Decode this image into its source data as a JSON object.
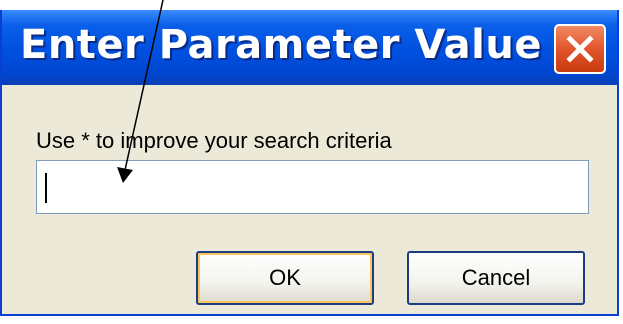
{
  "dialog": {
    "title": "Enter Parameter Value",
    "close_icon": "close-icon",
    "prompt": "Use * to improve your search criteria",
    "input_value": "",
    "ok_label": "OK",
    "cancel_label": "Cancel"
  },
  "annotation": {
    "type": "arrow",
    "points_to": "parameter-input",
    "color": "#000000"
  },
  "colors": {
    "titlebar": "#0050e0",
    "dialog_bg": "#ece9d8",
    "close_button": "#e2552c"
  }
}
